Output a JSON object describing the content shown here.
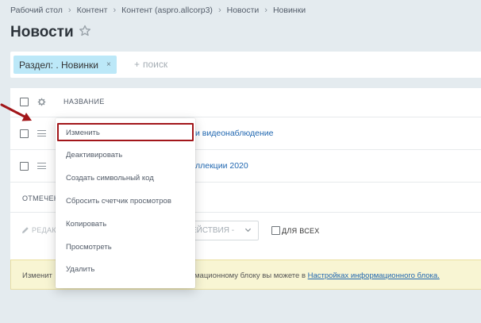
{
  "breadcrumbs": [
    "Рабочий стол",
    "Контент",
    "Контент (aspro.allcorp3)",
    "Новости",
    "Новинки"
  ],
  "page": {
    "title": "Новости"
  },
  "filter": {
    "tag_label": "Раздел: . Новинки",
    "tag_remove": "×",
    "search_placeholder": "поиск"
  },
  "grid": {
    "column_title": "НАЗВАНИЕ",
    "rows": [
      {
        "title_partial": "и видеонаблюдение"
      },
      {
        "title_partial": "ллекции 2020"
      }
    ],
    "selected_label": "ОТМЕЧЕН"
  },
  "actions": {
    "edit_label": "РЕДАК",
    "select_label": "ЕЙСТВИЯ -",
    "all_label": "ДЛЯ ВСЕХ"
  },
  "notice": {
    "text_start": "Изменит",
    "text_middle": "мационному блоку вы можете в",
    "link_text": "Настройках информационного блока."
  },
  "context_menu": {
    "items": [
      "Изменить",
      "Деактивировать",
      "Создать символьный код",
      "Сбросить счетчик просмотров",
      "Копировать",
      "Просмотреть",
      "Удалить"
    ]
  },
  "colors": {
    "highlight": "#a2161a",
    "link": "#2067b0",
    "tag_bg": "#bce8f8",
    "page_bg": "#e4ebef"
  }
}
